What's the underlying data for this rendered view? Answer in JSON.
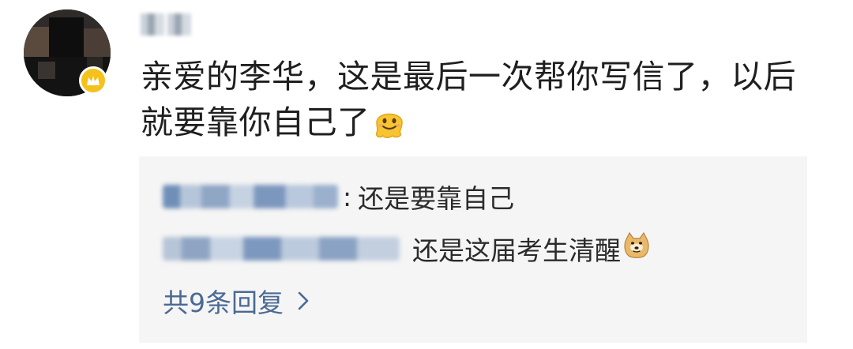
{
  "comment": {
    "text": "亲爱的李华，这是最后一次帮你写信了，以后就要靠你自己了",
    "emoji_icon": "melting-face-emoji"
  },
  "replies": [
    {
      "separator": ":",
      "text": "还是要靠自己"
    },
    {
      "text": "还是这届考生清醒",
      "emoji_icon": "doge-emoji"
    }
  ],
  "more_replies_label": "共9条回复",
  "colors": {
    "link": "#4a6a94",
    "reply_bg": "#f5f5f5",
    "text": "#1f1f1f",
    "badge": "#f4c21b"
  }
}
